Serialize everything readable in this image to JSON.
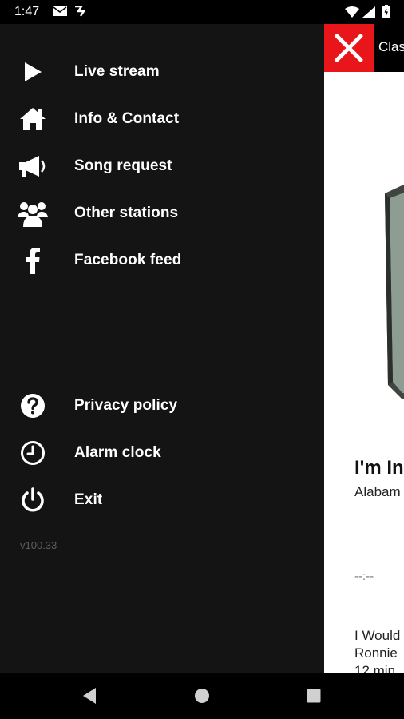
{
  "status_bar": {
    "time": "1:47",
    "icons": [
      "mail-icon",
      "app-logo-icon",
      "wifi-icon",
      "signal-icon",
      "battery-icon"
    ]
  },
  "drawer": {
    "items": [
      {
        "label": "Live stream",
        "icon": "play-icon"
      },
      {
        "label": "Info & Contact",
        "icon": "home-icon"
      },
      {
        "label": "Song request",
        "icon": "megaphone-icon"
      },
      {
        "label": "Other stations",
        "icon": "group-icon"
      },
      {
        "label": "Facebook feed",
        "icon": "facebook-icon"
      },
      {
        "label": "Privacy policy",
        "icon": "question-circle-icon"
      },
      {
        "label": "Alarm clock",
        "icon": "clock-icon"
      },
      {
        "label": "Exit",
        "icon": "power-icon"
      }
    ],
    "version": "v100.33"
  },
  "app": {
    "title": "Clas",
    "close_color": "#e8151b",
    "now_playing": {
      "title": "I'm In",
      "artist": "Alabam",
      "time": "--:--"
    },
    "next": {
      "line1": "I Would",
      "line2": "Ronnie",
      "line3": "12 min"
    }
  },
  "navbar": {
    "buttons": [
      "back-icon",
      "home-circle-icon",
      "recents-icon"
    ]
  },
  "colors": {
    "drawer_bg": "#141414",
    "accent_red": "#e8151b",
    "text_primary": "#ffffff",
    "version_text": "#5e5e5e"
  }
}
